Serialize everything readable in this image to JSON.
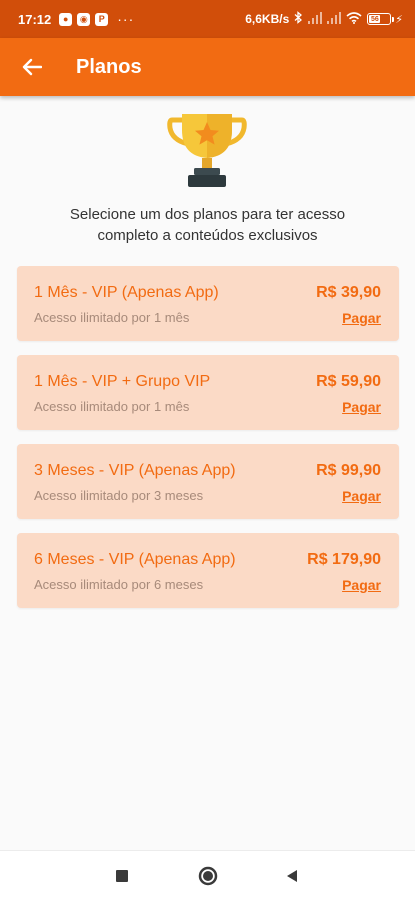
{
  "status_bar": {
    "time": "17:12",
    "notifications": [
      "circle-icon",
      "circle-icon",
      "p-icon"
    ],
    "notif_p": "P",
    "more": "···",
    "speed": "6,6KB/s",
    "battery": "56"
  },
  "app_bar": {
    "title": "Planos",
    "color": "#f26b12"
  },
  "intro": {
    "line1": "Selecione um dos planos para ter acesso",
    "line2": "completo a conteúdos exclusivos"
  },
  "plans": [
    {
      "name": "1 Mês - VIP (Apenas App)",
      "price": "R$ 39,90",
      "desc": "Acesso ilimitado por 1 mês",
      "action": "Pagar"
    },
    {
      "name": "1 Mês - VIP + Grupo VIP",
      "price": "R$ 59,90",
      "desc": "Acesso ilimitado por 1 mês",
      "action": "Pagar"
    },
    {
      "name": "3 Meses - VIP (Apenas App)",
      "price": "R$ 99,90",
      "desc": "Acesso ilimitado por 3 meses",
      "action": "Pagar"
    },
    {
      "name": "6 Meses - VIP (Apenas App)",
      "price": "R$ 179,90",
      "desc": "Acesso ilimitado por 6 meses",
      "action": "Pagar"
    }
  ],
  "nav": {
    "icons": [
      "recents-square-icon",
      "home-circle-icon",
      "back-triangle-icon"
    ]
  }
}
